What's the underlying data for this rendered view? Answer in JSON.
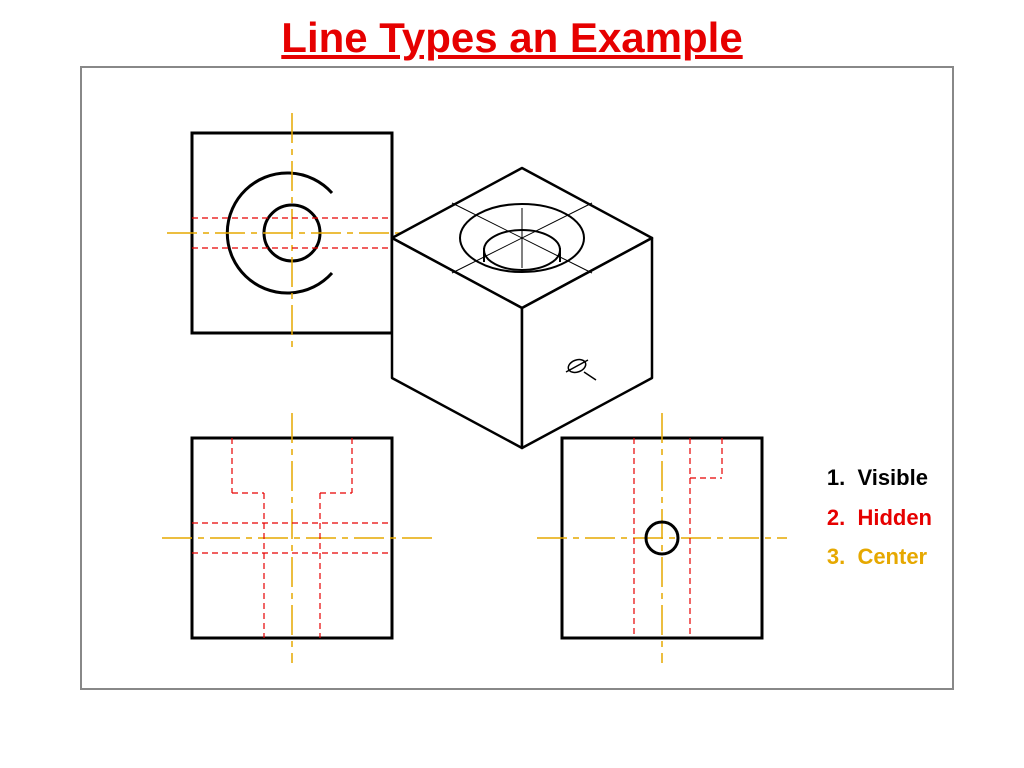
{
  "title": "Line Types an Example",
  "legend": {
    "item1": "Visible",
    "item2": "Hidden",
    "item3": "Center"
  },
  "colors": {
    "visible": "#000000",
    "hidden": "#e60000",
    "center": "#e6a800"
  }
}
